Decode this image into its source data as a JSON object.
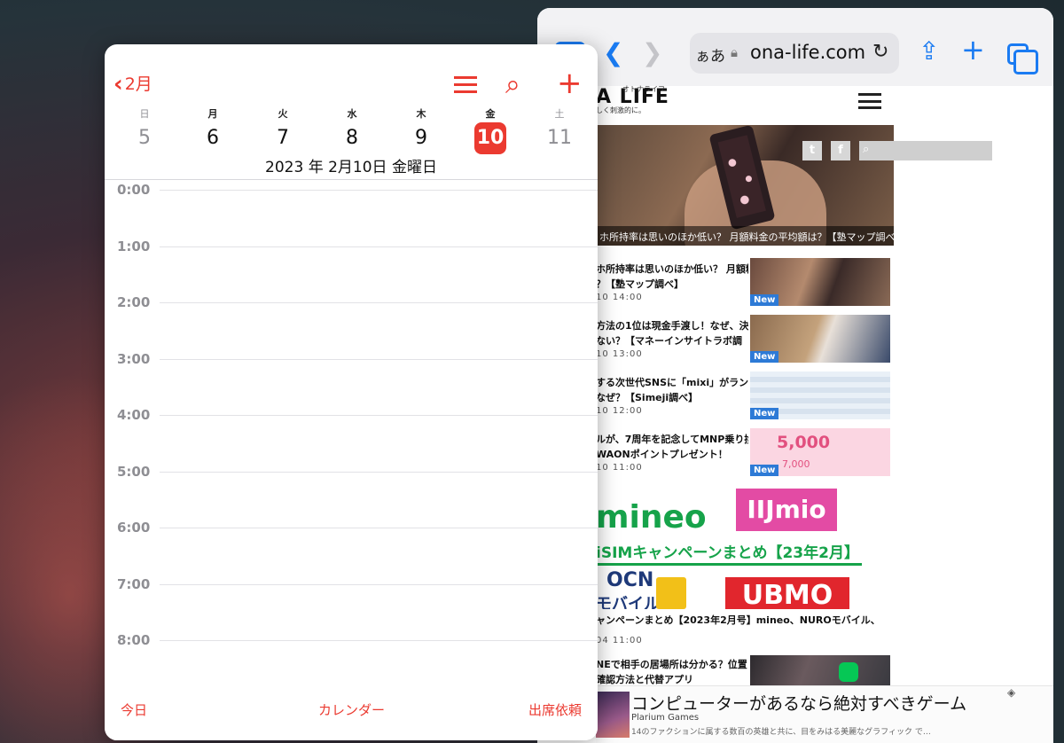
{
  "safari": {
    "address_aa": "ぁあ",
    "url": "ona-life.com",
    "site": {
      "logo": "A LIFE",
      "logo_ruby": "オトナライフ",
      "logo_tagline": "しく刺激的に。",
      "hero_caption": "ホ所持率は思いのほか低い？ 月額料金の平均額は？【塾マップ調べ】",
      "articles": [
        {
          "title_line1": "ホ所持率は思いのほか低い？ 月額料",
          "title_line2": "？【塾マップ調べ】",
          "date": "10 14:00",
          "badge": "New"
        },
        {
          "title_line1": "方法の1位は現金手渡し！なぜ、決",
          "title_line2": "ない？【マネーインサイトラボ調",
          "date": "10 13:00",
          "badge": "New"
        },
        {
          "title_line1": "する次世代SNSに「mixi」がラン",
          "title_line2": "なぜ？【Simeji調べ】",
          "date": "10 12:00",
          "badge": "New"
        },
        {
          "title_line1": "ルが、7周年を記念してMNP乗り換",
          "title_line2": "WAONポイントプレゼント！",
          "date": "10 11:00",
          "badge": "New"
        }
      ],
      "thumb4_big": "5,000",
      "thumb4_small": "7,000",
      "banner": {
        "mineo": "mineo",
        "iij": "IIJmio",
        "text": "iSIMキャンペーンまとめ【23年2月】",
        "ocn": "OCN",
        "ocn_sub": "モバイル",
        "nuro": "UBMO"
      },
      "article6": {
        "title": "ャンペーンまとめ【2023年2月号】mineo、NUROモバイル、",
        "date": "04 11:00"
      },
      "article7": {
        "title_line1": "NEで相手の居場所は分かる？位置",
        "title_line2": "確認方法と代替アプリ"
      },
      "ad": {
        "title": "コンピューターがあるなら絶対すべきゲーム",
        "advertiser": "Plarium Games",
        "description": "14のファクションに属する数百の英雄と共に、目をみはる美麗なグラフィック で…"
      }
    }
  },
  "calendar": {
    "month_back": "2月",
    "weekdays": [
      {
        "label": "日"
      },
      {
        "label": "月"
      },
      {
        "label": "火"
      },
      {
        "label": "水"
      },
      {
        "label": "木"
      },
      {
        "label": "金"
      },
      {
        "label": "土"
      }
    ],
    "days": [
      "5",
      "6",
      "7",
      "8",
      "9",
      "10",
      "11"
    ],
    "selected_date": "2023 年 2月10日 金曜日",
    "hours": [
      "0:00",
      "1:00",
      "2:00",
      "3:00",
      "4:00",
      "5:00",
      "6:00",
      "7:00",
      "8:00"
    ],
    "bottom": {
      "today": "今日",
      "calendars": "カレンダー",
      "inbox": "出席依頼"
    },
    "accent_color": "#eb3a30"
  }
}
